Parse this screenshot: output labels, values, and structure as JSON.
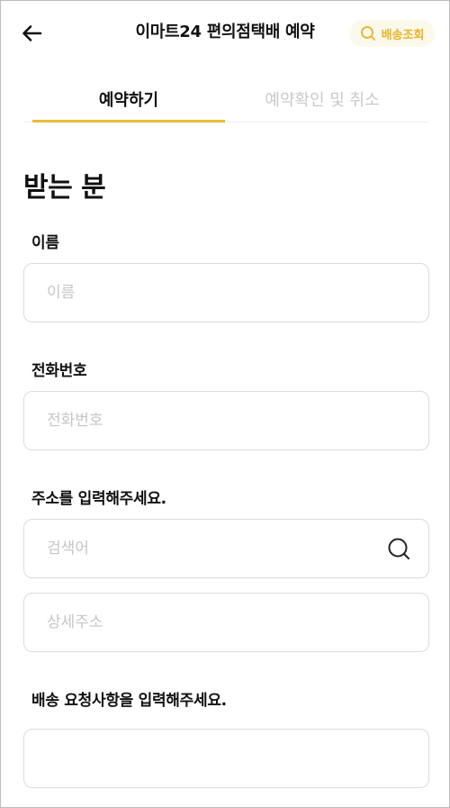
{
  "header": {
    "back_icon": "arrow-left-icon",
    "title": "이마트24 편의점택배 예약",
    "track_button": {
      "icon": "search-icon",
      "label": "배송조회"
    }
  },
  "tabs": [
    {
      "label": "예약하기",
      "active": true
    },
    {
      "label": "예약확인 및 취소",
      "active": false
    }
  ],
  "accent_color": "#EBBC3B",
  "section": {
    "title": "받는 분",
    "fields": {
      "name": {
        "label": "이름",
        "placeholder": "이름",
        "value": ""
      },
      "phone": {
        "label": "전화번호",
        "placeholder": "전화번호",
        "value": ""
      },
      "address": {
        "label": "주소를 입력해주세요.",
        "search_placeholder": "검색어",
        "detail_placeholder": "상세주소",
        "search_icon": "search-icon"
      },
      "request": {
        "label": "배송 요청사항을 입력해주세요.",
        "placeholder": "",
        "value": ""
      }
    }
  }
}
